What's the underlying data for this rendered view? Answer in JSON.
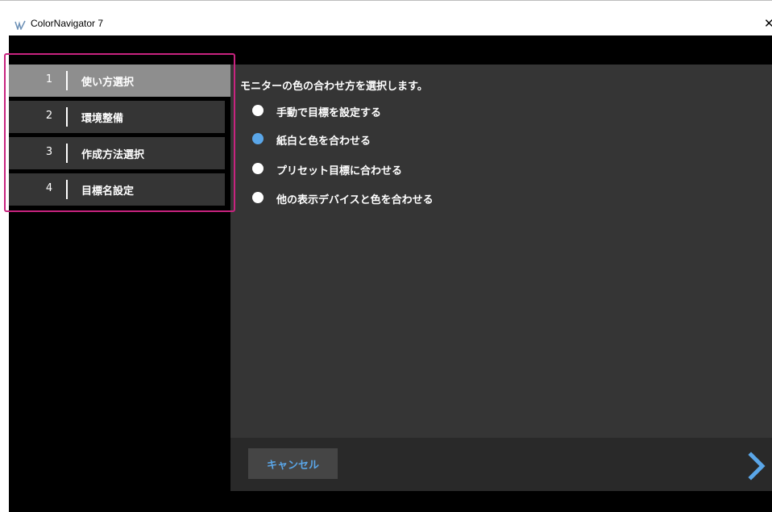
{
  "window": {
    "title": "ColorNavigator 7",
    "close_glyph": "✕"
  },
  "steps": [
    {
      "number": "1",
      "label": "使い方選択",
      "active": true
    },
    {
      "number": "2",
      "label": "環境整備",
      "active": false
    },
    {
      "number": "3",
      "label": "作成方法選択",
      "active": false
    },
    {
      "number": "4",
      "label": "目標名設定",
      "active": false
    }
  ],
  "main": {
    "question": "モニターの色の合わせ方を選択します。",
    "options": [
      {
        "label": "手動で目標を設定する",
        "selected": false
      },
      {
        "label": "紙白と色を合わせる",
        "selected": true
      },
      {
        "label": "プリセット目標に合わせる",
        "selected": false
      },
      {
        "label": "他の表示デバイスと色を合わせる",
        "selected": false
      }
    ]
  },
  "footer": {
    "cancel_label": "キャンセル",
    "next_icon": "chevron-right-icon"
  },
  "colors": {
    "accent": "#5aa6e8",
    "highlight_border": "#c8237f",
    "panel": "#353535",
    "active_step": "#8e8e8e"
  }
}
